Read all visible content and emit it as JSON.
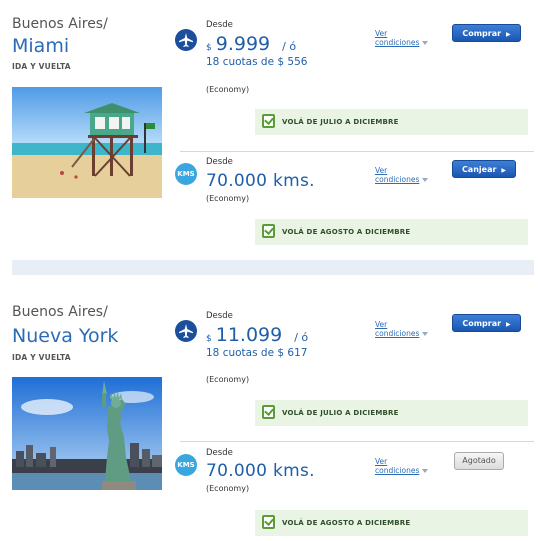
{
  "deals": [
    {
      "origin": "Buenos Aires/",
      "destination": "Miami",
      "trip_type": "IDA Y VUELTA",
      "offers": [
        {
          "icon": "plane-icon",
          "desde": "Desde",
          "currency": "$",
          "price": "9.999",
          "or": "/ ó",
          "installments": "18 cuotas de $ 556",
          "cabin": "(Economy)",
          "conditions_l1": "Ver",
          "conditions_l2": "condiciones",
          "button": "Comprar",
          "period": "VOLÁ DE JULIO A DICIEMBRE"
        },
        {
          "icon": "kms-icon",
          "icon_text": "KMS",
          "desde": "Desde",
          "kms": "70.000 kms.",
          "cabin": "(Economy)",
          "conditions_l1": "Ver",
          "conditions_l2": "condiciones",
          "button": "Canjear",
          "period": "VOLÁ DE AGOSTO A DICIEMBRE"
        }
      ]
    },
    {
      "origin": "Buenos Aires/",
      "destination": "Nueva York",
      "trip_type": "IDA Y VUELTA",
      "offers": [
        {
          "icon": "plane-icon",
          "desde": "Desde",
          "currency": "$",
          "price": "11.099",
          "or": "/ ó",
          "installments": "18 cuotas de $ 617",
          "cabin": "(Economy)",
          "conditions_l1": "Ver",
          "conditions_l2": "condiciones",
          "button": "Comprar",
          "period": "VOLÁ DE JULIO A DICIEMBRE"
        },
        {
          "icon": "kms-icon",
          "icon_text": "KMS",
          "desde": "Desde",
          "kms": "70.000 kms.",
          "cabin": "(Economy)",
          "conditions_l1": "Ver",
          "conditions_l2": "condiciones",
          "button": "Agotado",
          "period": "VOLÁ DE AGOSTO A DICIEMBRE"
        }
      ]
    }
  ],
  "colors": {
    "brand_blue": "#1f5ea8",
    "button_blue": "#1b56b0",
    "banner_green": "#e9f4e4",
    "check_green": "#5a9c36"
  }
}
